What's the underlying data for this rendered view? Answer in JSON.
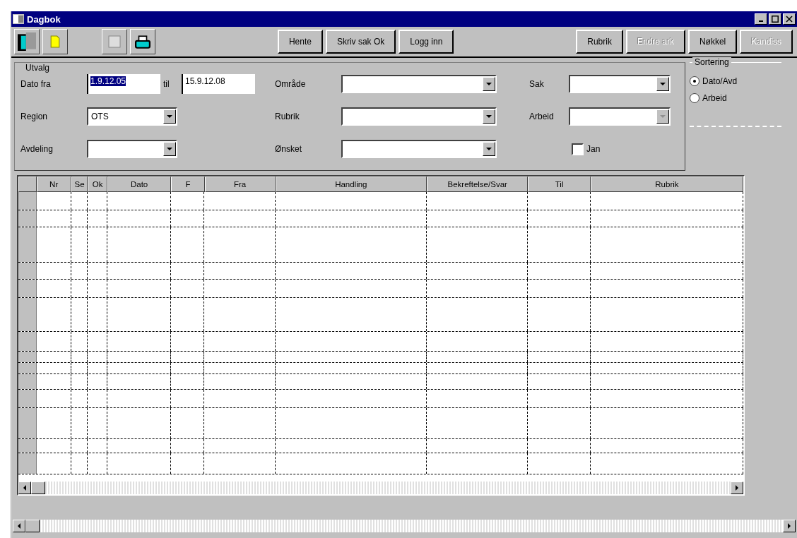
{
  "window": {
    "title": "Dagbok"
  },
  "toolbar": {
    "buttons": [
      {
        "label": "Hente",
        "disabled": false
      },
      {
        "label": "Skriv sak Ok",
        "disabled": false
      },
      {
        "label": "Logg inn",
        "disabled": false
      }
    ],
    "right_buttons": [
      {
        "label": "Rubrik",
        "disabled": false
      },
      {
        "label": "Endre ark",
        "disabled": true
      },
      {
        "label": "Nøkkel",
        "disabled": false
      },
      {
        "label": "Kandiss",
        "disabled": true
      }
    ]
  },
  "filter": {
    "title": "Utvalg",
    "date_from": {
      "label": "Dato fra",
      "value": "1.9.12.05"
    },
    "date_to": {
      "label": "til",
      "value": "15.9.12.08"
    },
    "region": {
      "label": "Region",
      "value": "OTS"
    },
    "department": {
      "label": "Avdeling"
    },
    "area": {
      "label": "Område"
    },
    "rubric": {
      "label": "Rubrik"
    },
    "wish": {
      "label": "Ønsket"
    },
    "case": {
      "label": "Sak"
    },
    "work": {
      "label": "Arbeid",
      "disabled": true
    },
    "checkbox": {
      "label": "Jan",
      "checked": false
    }
  },
  "sorting": {
    "title": "Sortering",
    "options": [
      {
        "label": "Dato/Avd",
        "selected": true
      },
      {
        "label": "Arbeid",
        "selected": false
      }
    ]
  },
  "table": {
    "columns": [
      "Nr",
      "Se",
      "Ok",
      "Dato",
      "F",
      "Fra",
      "Handling",
      "Bekreftelse/Svar",
      "Til",
      "Rubrik"
    ]
  }
}
